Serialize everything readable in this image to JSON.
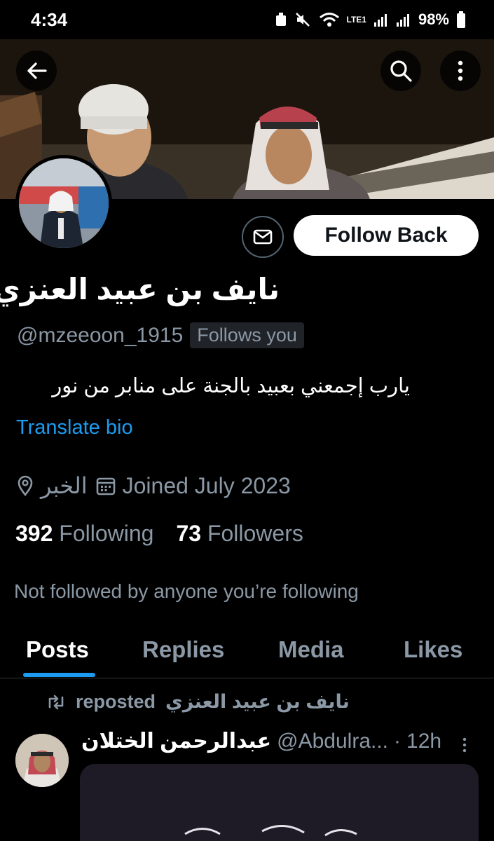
{
  "status_bar": {
    "time": "4:34",
    "battery": "98%",
    "network_label": "LTE1"
  },
  "profile": {
    "display_name": "نايف بن عبيد العنزي",
    "handle": "@mzeeoon_1915",
    "follows_you_badge": "Follows you",
    "bio": "يارب إجمعني بعبيد بالجنة على منابر من نور",
    "translate_bio": "Translate bio",
    "location": "الخبر",
    "joined": "Joined July 2023",
    "following_count": "392",
    "following_label": "Following",
    "followers_count": "73",
    "followers_label": "Followers",
    "not_followed": "Not followed by anyone you’re following"
  },
  "actions": {
    "follow_back_label": "Follow Back"
  },
  "tabs": [
    {
      "label": "Posts",
      "active": true
    },
    {
      "label": "Replies",
      "active": false
    },
    {
      "label": "Media",
      "active": false
    },
    {
      "label": "Likes",
      "active": false
    }
  ],
  "post": {
    "reposter": "نايف بن عبيد العنزي",
    "reposted_label": "reposted",
    "author": "عبدالرحمن الختلان",
    "handle": "@Abdulra...",
    "dot": "·",
    "time": "12h"
  },
  "colors": {
    "accent": "#1d9bf0",
    "background": "#000000",
    "secondary_text": "#8b98a5"
  },
  "icons": [
    "back-arrow-icon",
    "search-icon",
    "more-vertical-icon",
    "mail-icon",
    "location-pin-icon",
    "calendar-icon",
    "repost-icon"
  ]
}
